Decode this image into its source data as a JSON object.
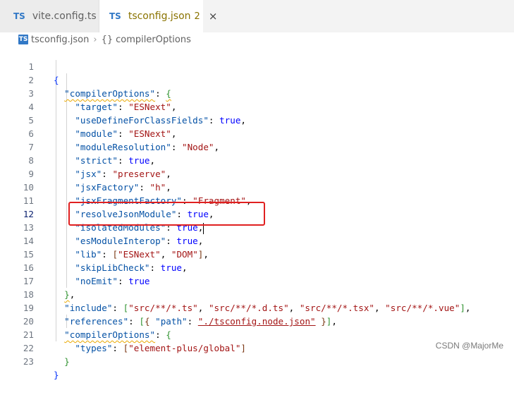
{
  "tabs": [
    {
      "icon": "TS",
      "label": "vite.config.ts"
    },
    {
      "icon": "TS",
      "label": "tsconfig.json",
      "problems": "2",
      "close": "×"
    }
  ],
  "breadcrumb": {
    "file": "tsconfig.json",
    "separator": "›",
    "symbol_icon": "{}",
    "symbol": "compilerOptions"
  },
  "code": {
    "l1": "{",
    "l2_key": "\"compilerOptions\"",
    "l2_rest": ":",
    "l2_brace": "{",
    "l3_key": "\"target\"",
    "l3_val": "\"ESNext\"",
    "l4_key": "\"useDefineForClassFields\"",
    "l4_val": "true",
    "l5_key": "\"module\"",
    "l5_val": "\"ESNext\"",
    "l6_key": "\"moduleResolution\"",
    "l6_val": "\"Node\"",
    "l7_key": "\"strict\"",
    "l7_val": "true",
    "l8_key": "\"jsx\"",
    "l8_val": "\"preserve\"",
    "l9_key": "\"jsxFactory\"",
    "l9_val": "\"h\"",
    "l10_key": "\"jsxFragmentFactory\"",
    "l10_val": "\"Fragment\"",
    "l11_key": "\"resolveJsonModule\"",
    "l11_val": "true",
    "l12_key": "\"isolatedModules\"",
    "l12_val": "true",
    "l13_key": "\"esModuleInterop\"",
    "l13_val": "true",
    "l14_key": "\"lib\"",
    "l14_v1": "\"ESNext\"",
    "l14_v2": "\"DOM\"",
    "l15_key": "\"skipLibCheck\"",
    "l15_val": "true",
    "l16_key": "\"noEmit\"",
    "l16_val": "true",
    "l17": "}",
    "l18_key": "\"include\"",
    "l18_v1": "\"src/**/*.ts\"",
    "l18_v2": "\"src/**/*.d.ts\"",
    "l18_v3": "\"src/**/*.tsx\"",
    "l18_v4": "\"src/**/*.vue\"",
    "l19_key": "\"references\"",
    "l19_path": "\"path\"",
    "l19_val": "\"./tsconfig.node.json\"",
    "l20_key": "\"compilerOptions\"",
    "l21_key": "\"types\"",
    "l21_val": "\"element-plus/global\"",
    "l22": "}",
    "l23": "}"
  },
  "line_numbers": [
    "1",
    "2",
    "3",
    "4",
    "5",
    "6",
    "7",
    "8",
    "9",
    "10",
    "11",
    "12",
    "13",
    "14",
    "15",
    "16",
    "17",
    "18",
    "19",
    "20",
    "21",
    "22",
    "23"
  ],
  "watermark": "CSDN @MajorMe",
  "colors": {
    "key": "#0451a5",
    "string": "#a31515",
    "keyword": "#0000ff",
    "highlight_box": "#e02020",
    "warning_squiggle": "#e9a800"
  }
}
